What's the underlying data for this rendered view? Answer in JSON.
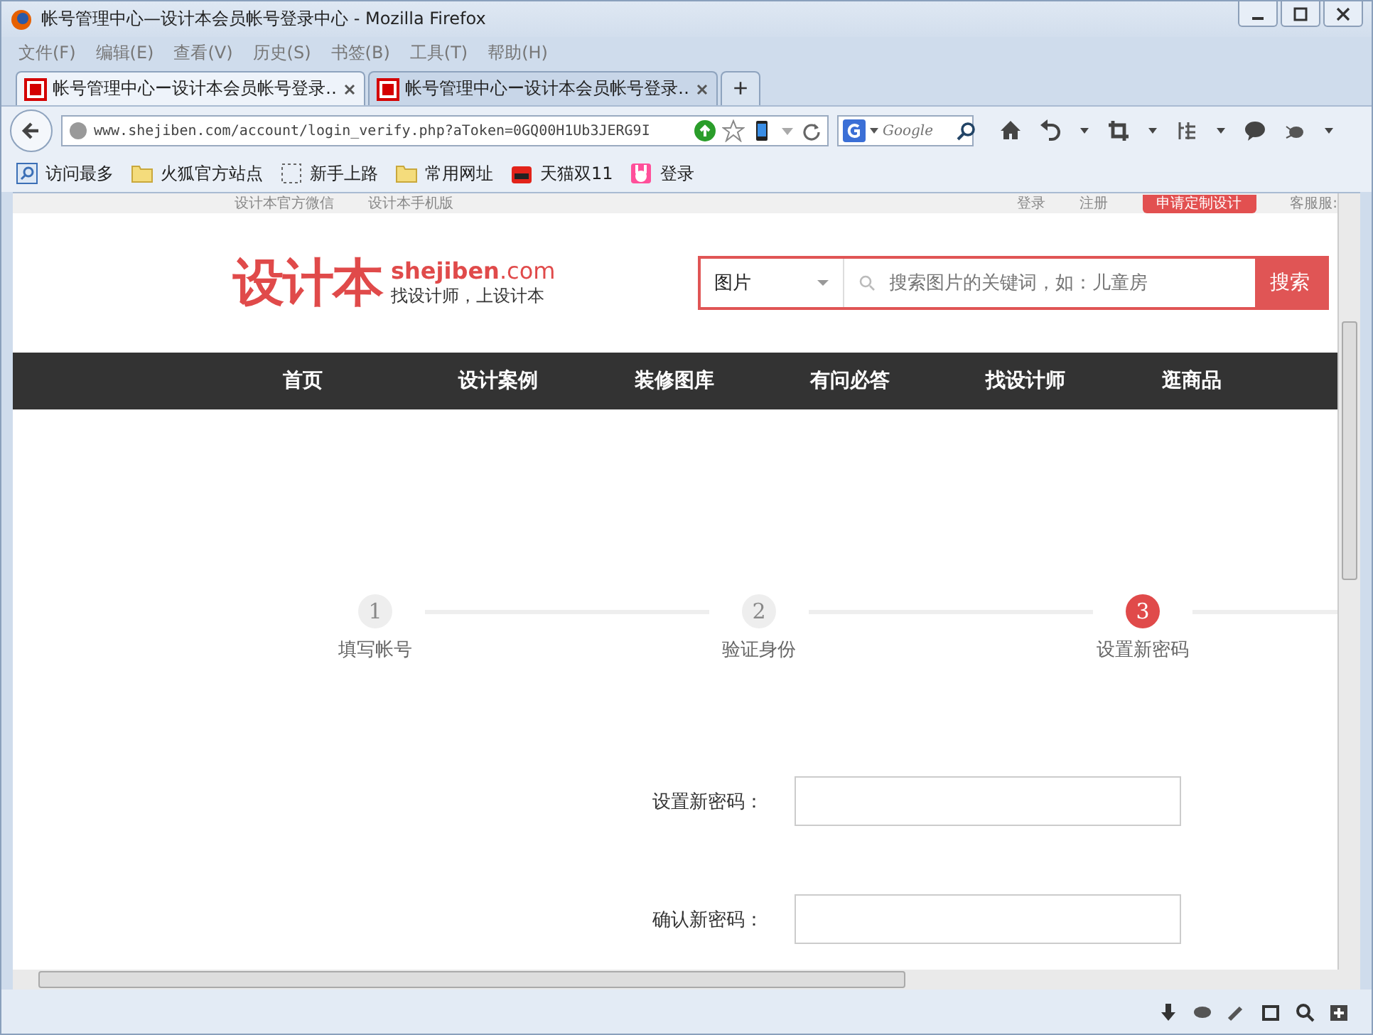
{
  "window": {
    "title": "帐号管理中心—设计本会员帐号登录中心 - Mozilla Firefox"
  },
  "menu": [
    "文件(F)",
    "编辑(E)",
    "查看(V)",
    "历史(S)",
    "书签(B)",
    "工具(T)",
    "帮助(H)"
  ],
  "tabs": [
    {
      "title": "帐号管理中心ー设计本会员帐号登录…",
      "selected": true
    },
    {
      "title": "帐号管理中心ー设计本会员帐号登录…",
      "selected": false
    }
  ],
  "new_tab": "+",
  "address": {
    "url": "www.shejiben.com/account/login_verify.php?aToken=0GQ00H1Ub3JERG9I"
  },
  "web_search": {
    "placeholder": "Google"
  },
  "bookmarks": [
    {
      "label": "访问最多",
      "kind": "search"
    },
    {
      "label": "火狐官方站点",
      "kind": "folder"
    },
    {
      "label": "新手上路",
      "kind": "dashed"
    },
    {
      "label": "常用网址",
      "kind": "folder"
    },
    {
      "label": "天猫双11",
      "kind": "cat"
    },
    {
      "label": "登录",
      "kind": "bunny"
    }
  ],
  "page": {
    "top_links": [
      {
        "label": "设计本官方微信",
        "kind": "left"
      },
      {
        "label": "设计本手机版",
        "kind": "left"
      },
      {
        "label": "登录",
        "kind": "right"
      },
      {
        "label": "注册",
        "kind": "right"
      },
      {
        "label": "申请定制设计",
        "kind": "button"
      },
      {
        "label": "客服服:",
        "kind": "right"
      }
    ],
    "logo": {
      "mark": "设计本",
      "domain": "shejiben",
      "tld": ".com",
      "slogan": "找设计师，上设计本"
    },
    "search": {
      "category": "图片",
      "placeholder": "搜索图片的关键词，如：儿童房",
      "button": "搜索"
    },
    "nav": [
      "首页",
      "设计案例",
      "装修图库",
      "有问必答",
      "找设计师",
      "逛商品"
    ],
    "steps": [
      {
        "number": "1",
        "label": "填写帐号",
        "selected": false
      },
      {
        "number": "2",
        "label": "验证身份",
        "selected": false
      },
      {
        "number": "3",
        "label": "设置新密码",
        "selected": true
      }
    ],
    "fields": [
      {
        "label": "设置新密码："
      },
      {
        "label": "确认新密码："
      }
    ]
  }
}
